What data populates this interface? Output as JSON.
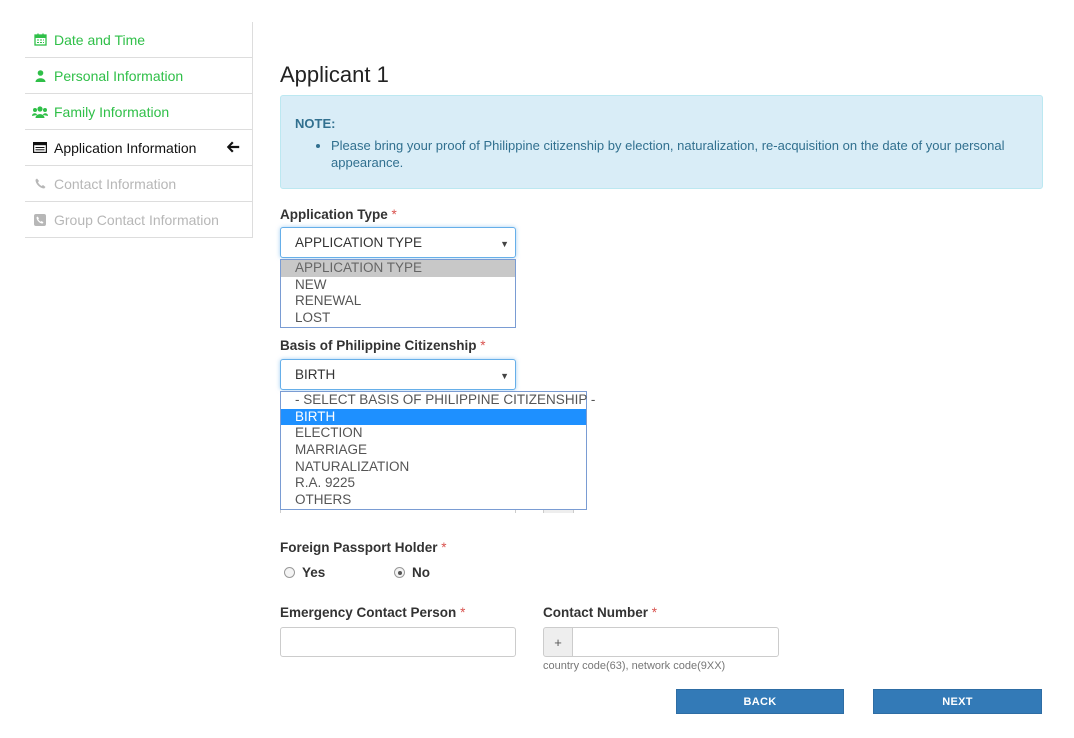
{
  "sidebar": {
    "items": [
      {
        "label": "Date and Time",
        "icon": "calendar-icon",
        "state": "done"
      },
      {
        "label": "Personal Information",
        "icon": "user-icon",
        "state": "done"
      },
      {
        "label": "Family Information",
        "icon": "users-icon",
        "state": "done"
      },
      {
        "label": "Application Information",
        "icon": "id-card-icon",
        "state": "active"
      },
      {
        "label": "Contact Information",
        "icon": "phone-icon",
        "state": "disabled"
      },
      {
        "label": "Group Contact Information",
        "icon": "phone-square-icon",
        "state": "disabled"
      }
    ],
    "active_arrow_icon": "arrow-left-icon"
  },
  "main": {
    "title": "Applicant 1",
    "note": {
      "title": "NOTE:",
      "text": "Please bring your proof of Philippine citizenship by election, naturalization, re-acquisition on the date of your personal appearance."
    },
    "application_type": {
      "label": "Application Type",
      "required_mark": "*",
      "value": "APPLICATION TYPE",
      "options": [
        "APPLICATION TYPE",
        "NEW",
        "RENEWAL",
        "LOST"
      ]
    },
    "citizenship_basis": {
      "label": "Basis of Philippine Citizenship",
      "required_mark": "*",
      "value": "BIRTH",
      "options": [
        "- SELECT BASIS OF PHILIPPINE CITIZENSHIP -",
        "BIRTH",
        "ELECTION",
        "MARRIAGE",
        "NATURALIZATION",
        "R.A. 9225",
        "OTHERS"
      ]
    },
    "foreign_passport": {
      "label": "Foreign Passport Holder",
      "required_mark": "*",
      "options": [
        "Yes",
        "No"
      ],
      "selected": "No"
    },
    "emergency_contact": {
      "label": "Emergency Contact Person",
      "required_mark": "*",
      "value": ""
    },
    "contact_number": {
      "label": "Contact Number",
      "required_mark": "*",
      "prefix": "+",
      "value": "",
      "help": "country code(63), network code(9XX)"
    },
    "buttons": {
      "back": "BACK",
      "next": "NEXT"
    }
  },
  "colors": {
    "done": "#2fbf48",
    "disabled": "#b7b7b7",
    "primary": "#337ab7",
    "note_bg": "#d9edf7",
    "required": "#d9534f"
  }
}
